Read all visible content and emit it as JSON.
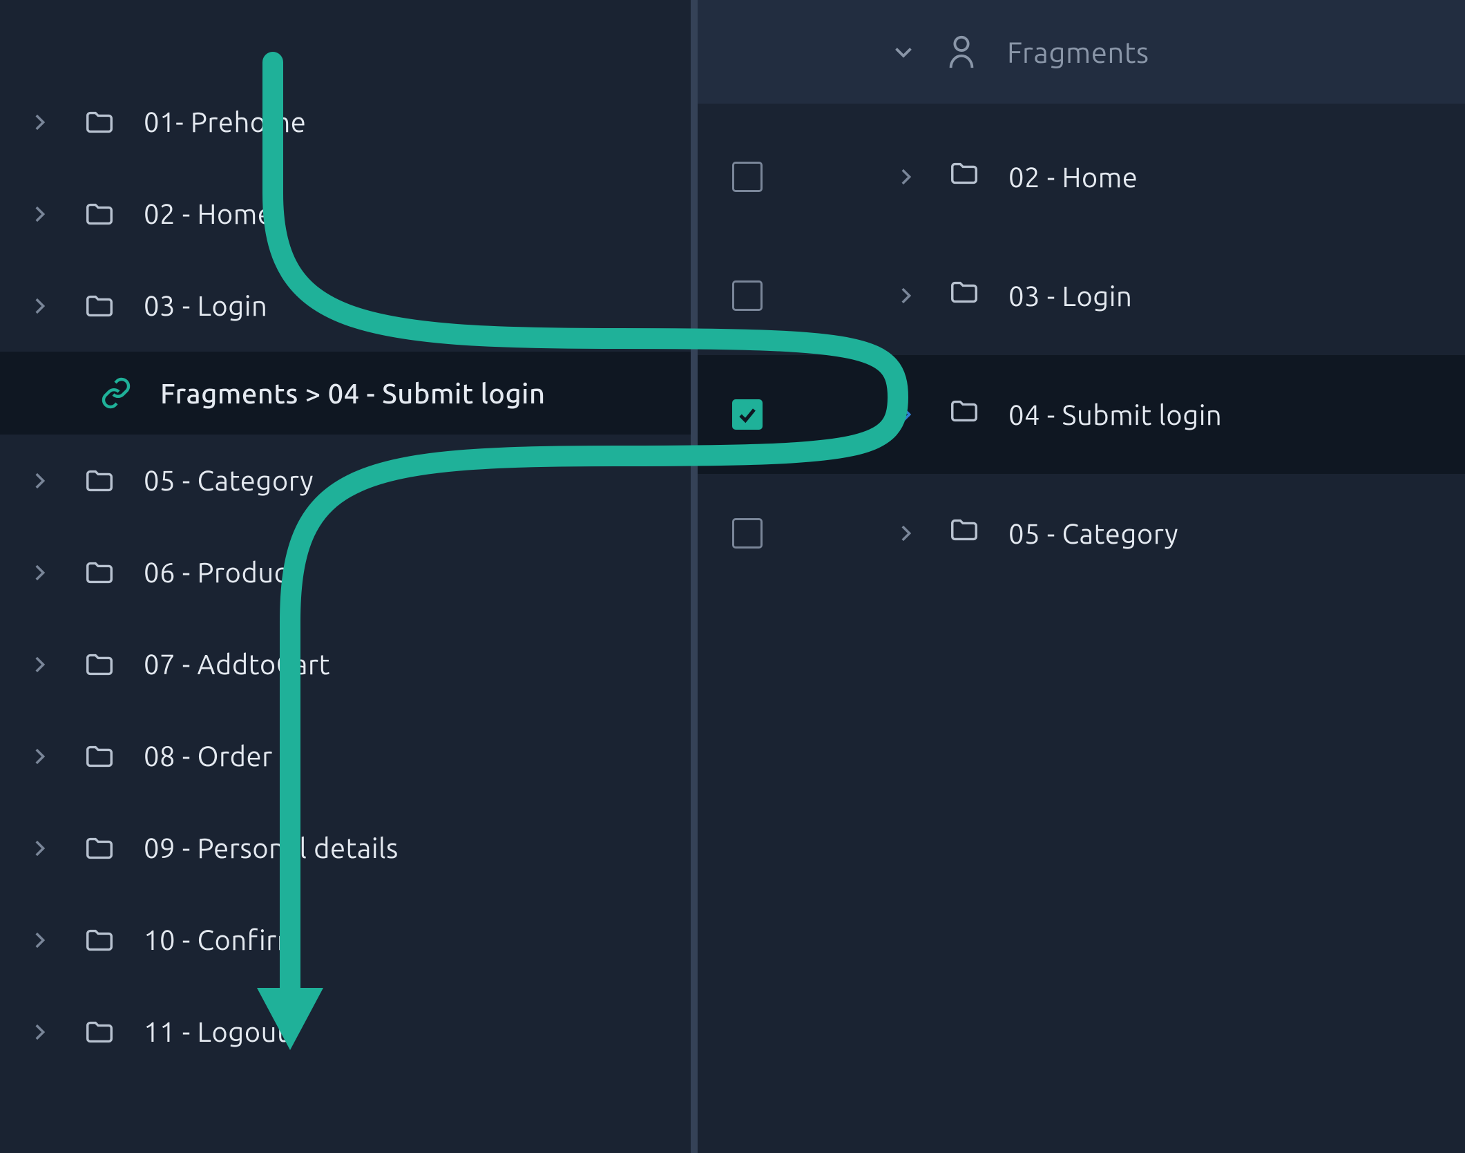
{
  "colors": {
    "accent": "#1fb199",
    "highlight_chevron": "#2d7fd1"
  },
  "left_panel": {
    "items": [
      {
        "label": "01- Prehome",
        "type": "folder"
      },
      {
        "label": "02 - Home",
        "type": "folder"
      },
      {
        "label": "03 - Login",
        "type": "folder"
      },
      {
        "label": "Fragments > 04 - Submit login",
        "type": "link",
        "indent": true
      },
      {
        "label": "05 - Category",
        "type": "folder"
      },
      {
        "label": "06 - Product",
        "type": "folder"
      },
      {
        "label": "07 - AddtoCart",
        "type": "folder"
      },
      {
        "label": "08 - Order",
        "type": "folder"
      },
      {
        "label": "09 - Personal details",
        "type": "folder"
      },
      {
        "label": "10 - Confirm",
        "type": "folder"
      },
      {
        "label": "11 - Logout",
        "type": "folder"
      }
    ]
  },
  "right_panel": {
    "header_label": "Fragments",
    "items": [
      {
        "label": "02 - Home",
        "checked": false,
        "selected": false
      },
      {
        "label": "03 - Login",
        "checked": false,
        "selected": false
      },
      {
        "label": "04 - Submit login",
        "checked": true,
        "selected": true
      },
      {
        "label": "05 - Category",
        "checked": false,
        "selected": false
      }
    ]
  }
}
